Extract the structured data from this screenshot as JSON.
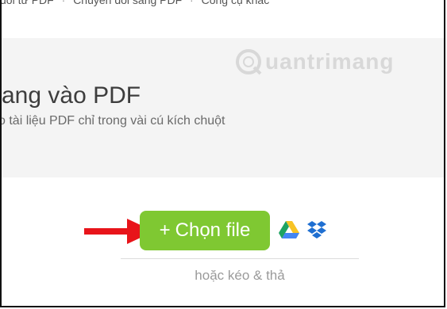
{
  "nav": {
    "items": [
      "đổi từ PDF",
      "Chuyển đổi sang PDF",
      "Công cụ khác"
    ],
    "separator": "·"
  },
  "hero": {
    "title": "rang vào PDF",
    "subtitle": "o tài liệu PDF chỉ trong vài cú kích chuột"
  },
  "watermark": {
    "text": "uantrimang"
  },
  "upload": {
    "button_plus": "+",
    "button_label": "Chọn file",
    "drag_text": "hoặc kéo & thả"
  },
  "icons": {
    "gdrive": "google-drive-icon",
    "dropbox": "dropbox-icon",
    "arrow": "red-arrow-annotation"
  },
  "colors": {
    "button": "#7fc832",
    "arrow": "#e8141a",
    "dropbox": "#1f6fd1"
  }
}
